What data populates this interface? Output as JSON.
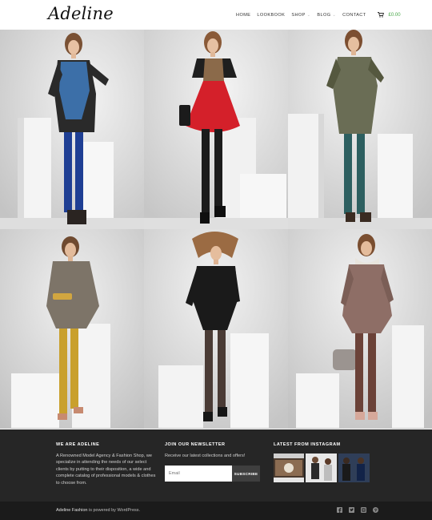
{
  "header": {
    "logo": "Adeline",
    "nav": [
      {
        "label": "Home",
        "has_dropdown": false
      },
      {
        "label": "Lookbook",
        "has_dropdown": false
      },
      {
        "label": "Shop",
        "has_dropdown": true
      },
      {
        "label": "Blog",
        "has_dropdown": true
      },
      {
        "label": "Contact",
        "has_dropdown": false
      }
    ],
    "cart_icon": "cart-icon",
    "cart_total": "£0.00",
    "accent_color": "#4aa84a"
  },
  "gallery": {
    "tiles": [
      {
        "name": "model-blue-dress",
        "top_color": "#3c6fa8",
        "legs_color": "#1f3f94"
      },
      {
        "name": "model-red-dress",
        "top_color": "#d4202a",
        "legs_color": "#1c1c1c"
      },
      {
        "name": "model-houndstooth-dress",
        "top_color": "#6a6d55",
        "legs_color": "#2d5f60"
      },
      {
        "name": "model-paisley-tunic",
        "top_color": "#7d7468",
        "legs_color": "#c9a02d"
      },
      {
        "name": "model-black-dress",
        "top_color": "#1a1a1a",
        "legs_color": "#4a3b35"
      },
      {
        "name": "model-print-dress",
        "top_color": "#8e6e66",
        "legs_color": "#6b4238"
      }
    ]
  },
  "footer": {
    "about": {
      "title": "We Are Adeline",
      "text": "A Renowned Model Agency & Fashion Shop, we specialize in attending the needs of our select clients by putting to their disposition, a wide and complete catalog of professional models & clothes to choose from."
    },
    "newsletter": {
      "title": "Join Our Newsletter",
      "text": "Receive our latest collections and offers!",
      "email_placeholder": "Email",
      "button_label": "SUBSCRIBE"
    },
    "instagram": {
      "title": "Latest From Instagram",
      "thumbs": [
        "instagram-photo-1",
        "instagram-photo-2",
        "instagram-photo-3"
      ]
    }
  },
  "bottom": {
    "brand": "Adeline Fashion",
    "suffix": " is powered by WordPress.",
    "social_icons": [
      "facebook-icon",
      "twitter-icon",
      "instagram-icon",
      "pinterest-icon"
    ]
  }
}
